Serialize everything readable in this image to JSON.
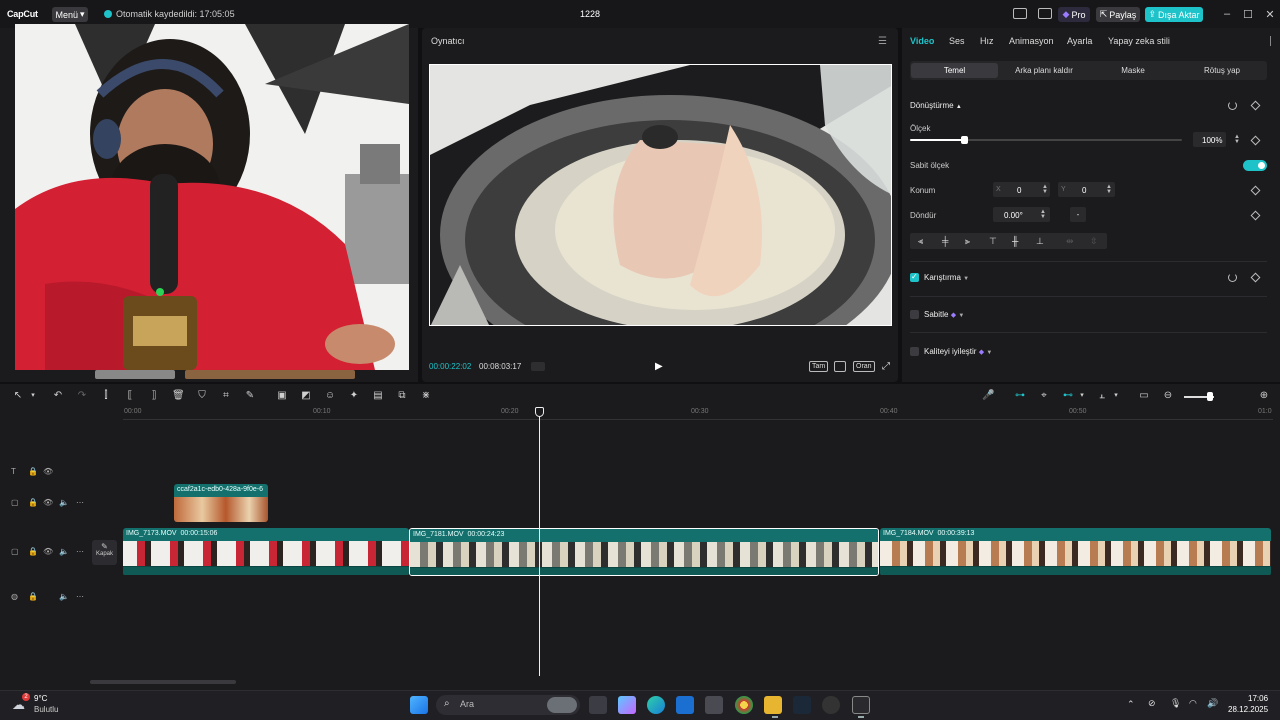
{
  "app": {
    "logo": "CapCut",
    "menu_label": "Menü",
    "autosave_text": "Otomatik kaydedildi: 17:05:05",
    "project_title": "1228",
    "pro_label": "Pro",
    "share_label": "Paylaş",
    "export_label": "Dışa Aktar",
    "accent_color": "#1ec3c9"
  },
  "player": {
    "title": "Oynatıcı",
    "current_time": "00:00:22:02",
    "total_time": "00:08:03:17",
    "controls": [
      "Tam",
      "Oran"
    ]
  },
  "inspector": {
    "tabs": [
      "Video",
      "Ses",
      "Hız",
      "Animasyon",
      "Ayarla",
      "Yapay zeka stili"
    ],
    "active_tab": "Video",
    "subtabs": [
      "Temel",
      "Arka planı kaldır",
      "Maske",
      "Rötuş yap"
    ],
    "active_subtab": "Temel",
    "transform_title": "Dönüştürme",
    "scale_label": "Ölçek",
    "scale_value": "100%",
    "scale_fraction": 0.2,
    "uniform_scale_label": "Sabit ölçek",
    "uniform_scale_on": true,
    "position_label": "Konum",
    "pos_x_label": "X",
    "pos_x": "0",
    "pos_y_label": "Y",
    "pos_y": "0",
    "rotate_label": "Döndür",
    "rotate_value": "0.00°",
    "rotate_extra": "-",
    "blend_label": "Karıştırma",
    "blend_checked": true,
    "stabilize_label": "Sabitle",
    "stabilize_checked": false,
    "enhance_label": "Kaliteyi iyileştir",
    "enhance_checked": false
  },
  "timeline": {
    "ruler_ticks": [
      "00:00",
      "00:10",
      "00:20",
      "00:30",
      "00:40",
      "00:50",
      "01:0"
    ],
    "cover_label": "Kapak",
    "overlay_clip_name": "ccaf2a1c-edb0-428a-9f0e-6",
    "clips": [
      {
        "name": "IMG_7173.MOV",
        "duration": "00:00:15:06"
      },
      {
        "name": "IMG_7181.MOV",
        "duration": "00:00:24:23"
      },
      {
        "name": "IMG_7184.MOV",
        "duration": "00:00:39:13"
      }
    ],
    "playhead_seconds": 22.07
  },
  "taskbar": {
    "weather_temp": "9°C",
    "weather_desc": "Bulutlu",
    "weather_badge": "2",
    "search_placeholder": "Ara",
    "time": "17:06",
    "date": "28.12.2025"
  }
}
